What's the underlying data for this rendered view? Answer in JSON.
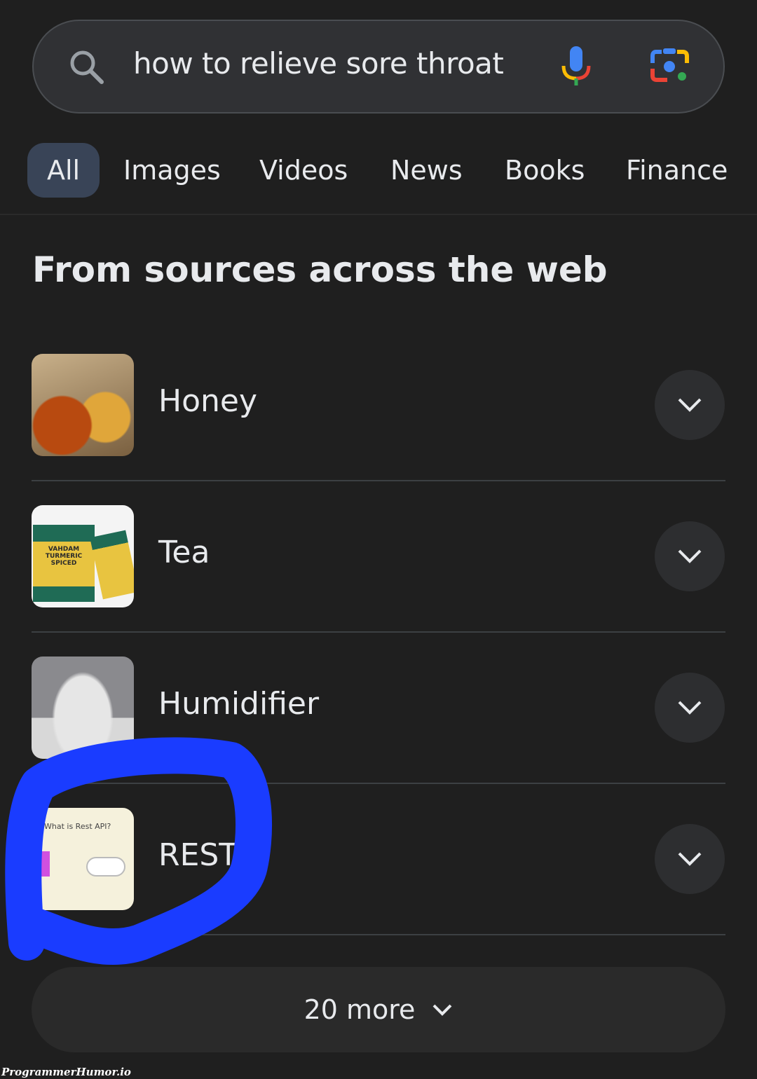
{
  "search": {
    "query": "how to relieve sore throat",
    "icons": [
      "search-icon",
      "mic-icon",
      "lens-icon"
    ]
  },
  "tabs": [
    {
      "label": "All",
      "active": true
    },
    {
      "label": "Images"
    },
    {
      "label": "Videos"
    },
    {
      "label": "News"
    },
    {
      "label": "Books"
    },
    {
      "label": "Finance"
    }
  ],
  "section": {
    "title": "From sources across the web"
  },
  "items": [
    {
      "label": "Honey"
    },
    {
      "label": "Tea",
      "thumb_text": "VAHDAM TURMERIC SPICED"
    },
    {
      "label": "Humidifier"
    },
    {
      "label": "REST",
      "thumb_text": "What is Rest API?"
    }
  ],
  "more": {
    "label": "20 more"
  },
  "watermark": "ProgrammerHumor.io",
  "colors": {
    "background": "#1f1f1f",
    "search_bg": "#303134",
    "active_tab": "#394457",
    "annotation": "#1a3cff"
  }
}
